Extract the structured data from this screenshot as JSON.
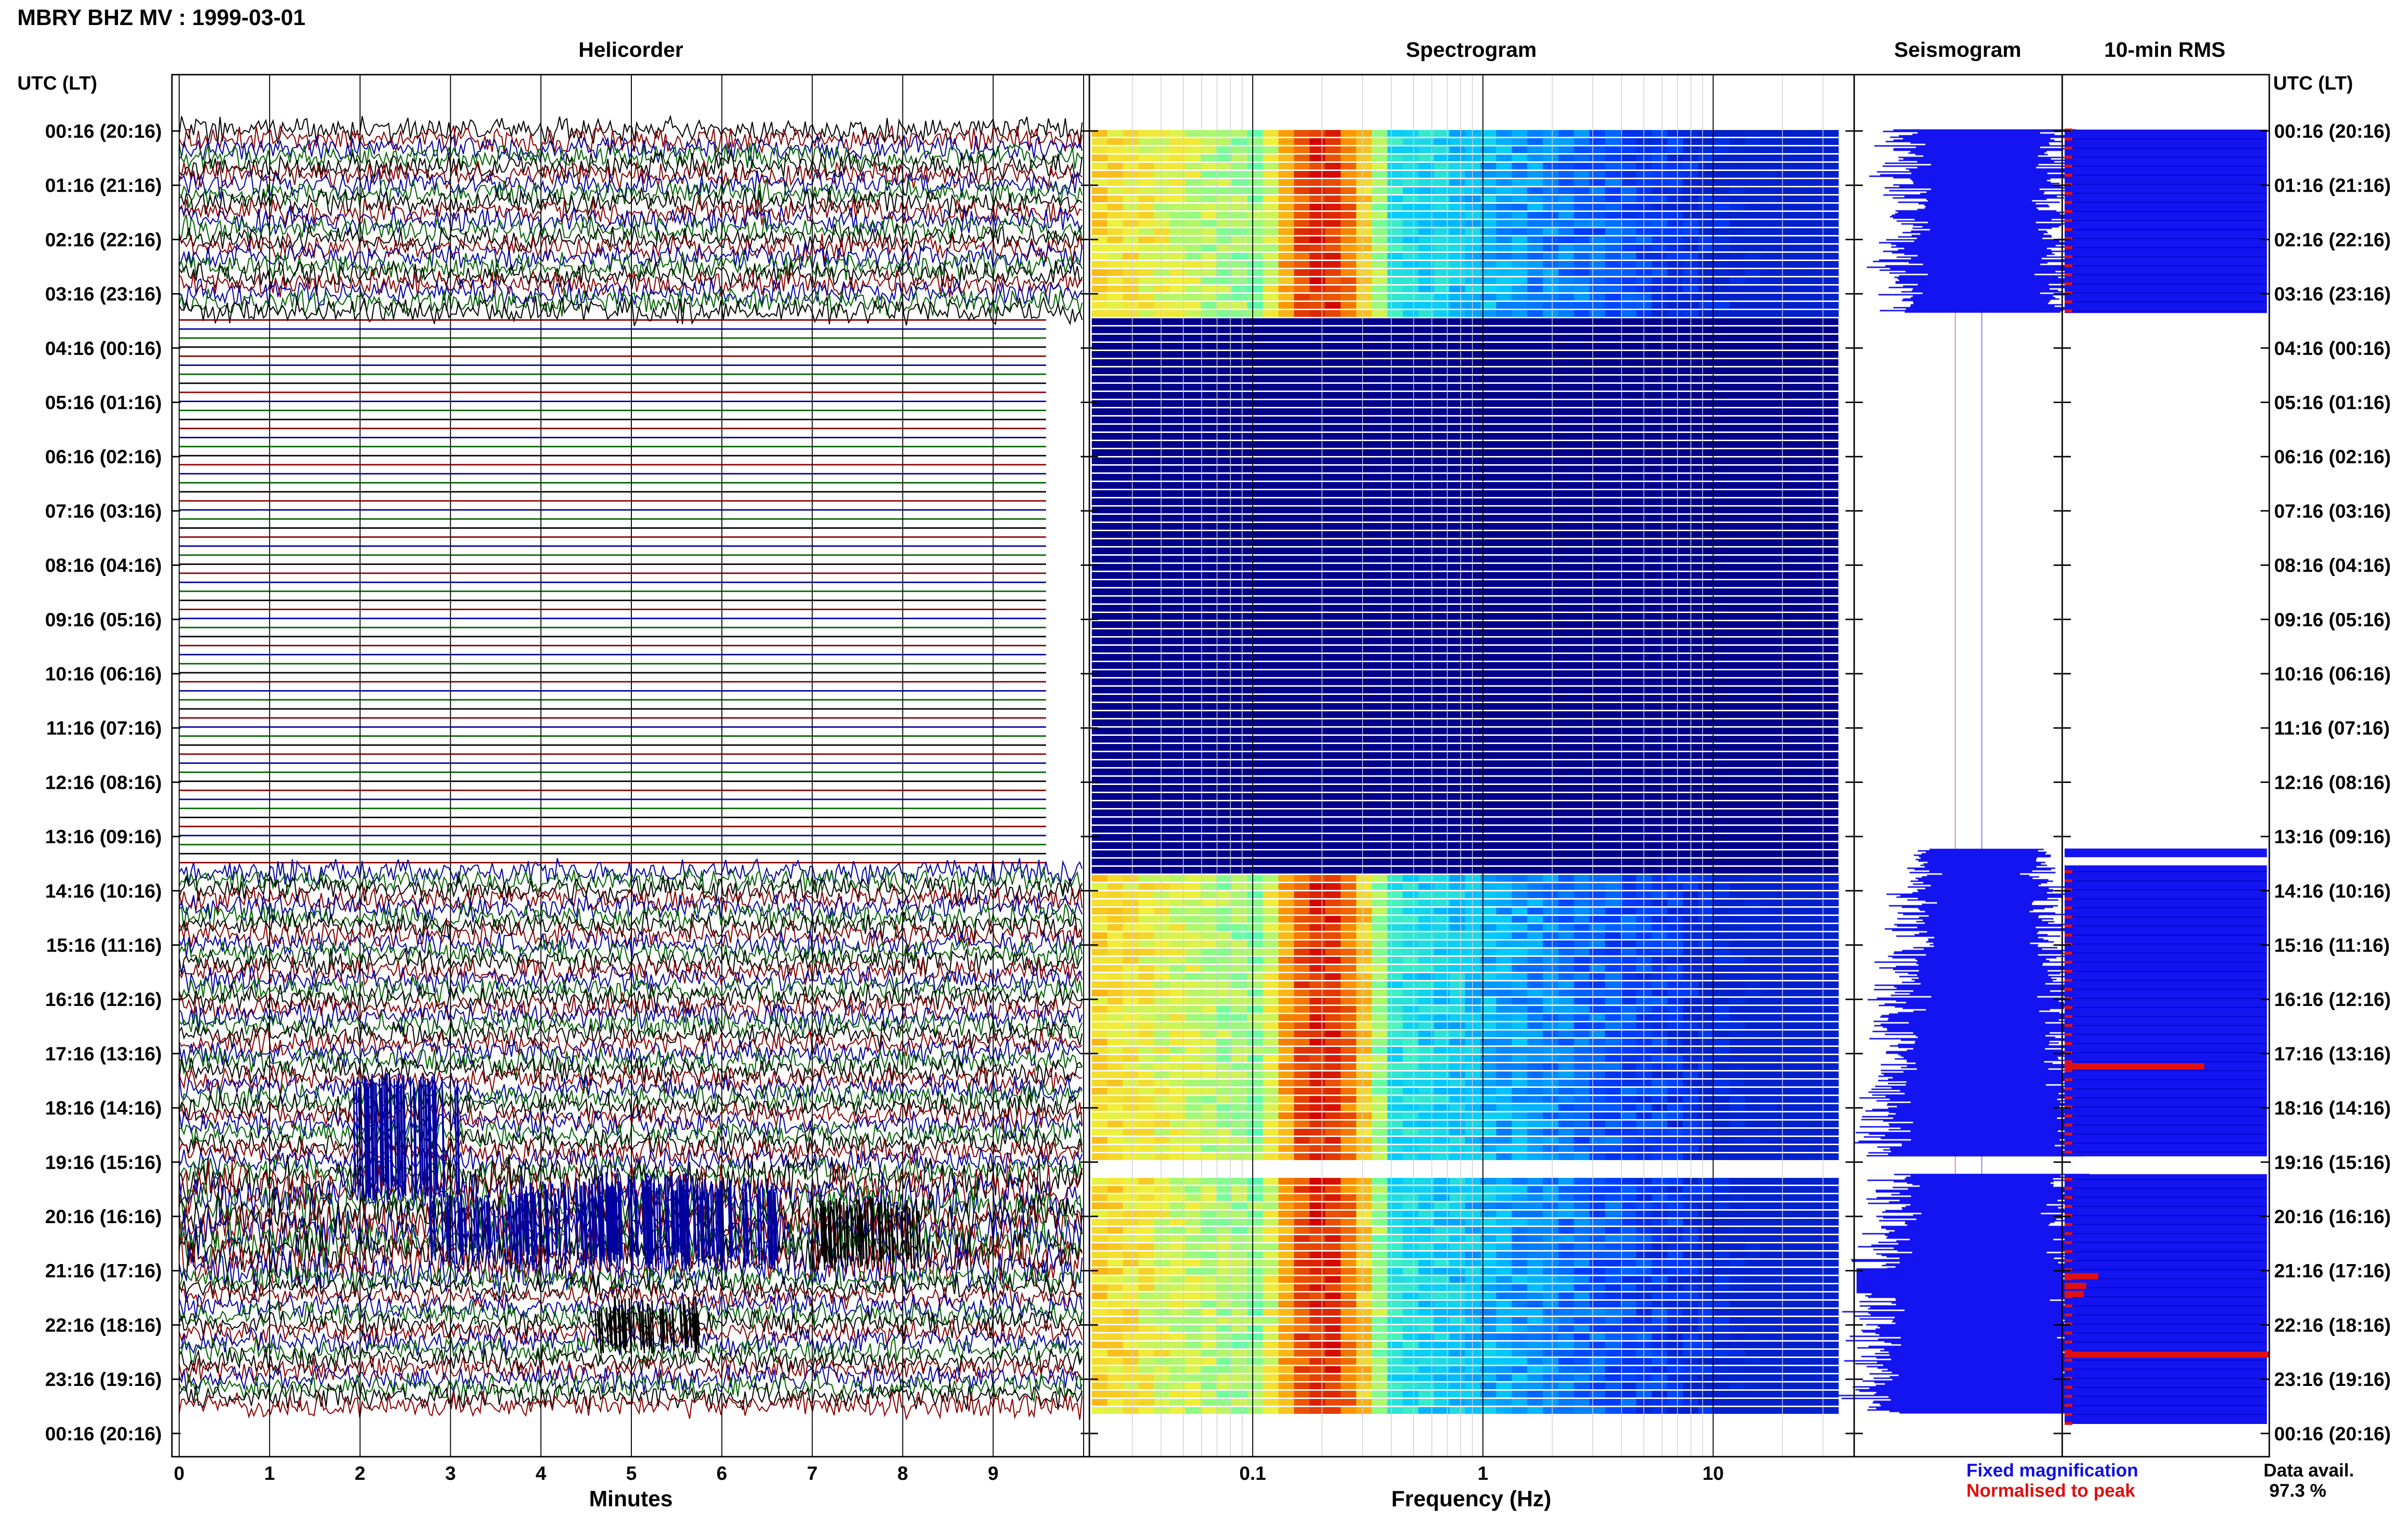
{
  "title": "MBRY BHZ MV : 1999-03-01",
  "panels": {
    "helicorder": "Helicorder",
    "spectrogram": "Spectrogram",
    "seismogram": "Seismogram",
    "rms": "10-min RMS"
  },
  "time_axis_label": "UTC (LT)",
  "time_labels": [
    "00:16 (20:16)",
    "01:16 (21:16)",
    "02:16 (22:16)",
    "03:16 (23:16)",
    "04:16 (00:16)",
    "05:16 (01:16)",
    "06:16 (02:16)",
    "07:16 (03:16)",
    "08:16 (04:16)",
    "09:16 (05:16)",
    "10:16 (06:16)",
    "11:16 (07:16)",
    "12:16 (08:16)",
    "13:16 (09:16)",
    "14:16 (10:16)",
    "15:16 (11:16)",
    "16:16 (12:16)",
    "17:16 (13:16)",
    "18:16 (14:16)",
    "19:16 (15:16)",
    "20:16 (16:16)",
    "21:16 (17:16)",
    "22:16 (18:16)",
    "23:16 (19:16)",
    "00:16 (20:16)"
  ],
  "helicorder_xlabel": "Minutes",
  "helicorder_ticks": [
    "0",
    "1",
    "2",
    "3",
    "4",
    "5",
    "6",
    "7",
    "8",
    "9"
  ],
  "spectrogram_xlabel": "Frequency (Hz)",
  "spectrogram_ticks": [
    "0.1",
    "1",
    "10"
  ],
  "legend": {
    "fixed": "Fixed magnification",
    "normalised": "Normalised to peak",
    "fixed_color": "#1010e0",
    "normalised_color": "#e01010"
  },
  "data_avail": {
    "label": "Data avail.",
    "value": "97.3 %"
  },
  "colors": {
    "trace_cycle": [
      "#000000",
      "#8b0000",
      "#0000a0",
      "#006400"
    ],
    "spectrogram_cold": "#00008b",
    "rms_fill": "#1414f0",
    "rms_peak": "#e01010"
  },
  "chart_data": {
    "type": "helicorder",
    "hours_utc": [
      "00:16",
      "01:16",
      "02:16",
      "03:16",
      "04:16",
      "05:16",
      "06:16",
      "07:16",
      "08:16",
      "09:16",
      "10:16",
      "11:16",
      "12:16",
      "13:16",
      "14:16",
      "15:16",
      "16:16",
      "17:16",
      "18:16",
      "19:16",
      "20:16",
      "21:16",
      "22:16",
      "23:16"
    ],
    "minutes_range": [
      0,
      10
    ],
    "frequency_range_hz": [
      0.02,
      40
    ],
    "frequency_scale": "log",
    "data_gap_utc": [
      "03:30",
      "13:40"
    ],
    "second_gap_utc": [
      "19:10",
      "19:20"
    ],
    "spectral_peak_hz": 0.2,
    "strong_event_utc": "21:16",
    "data_availability_percent": 97.3
  }
}
